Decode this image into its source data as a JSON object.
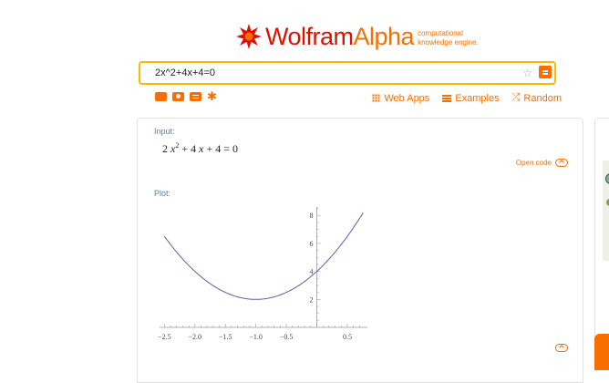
{
  "logo": {
    "brand_part1": "Wolfram",
    "brand_part2": "Alpha",
    "tagline_line1": "computational",
    "tagline_line2": "knowledge engine."
  },
  "search": {
    "value": "2x^2+4x+4=0"
  },
  "toolbar": {
    "icons": [
      "keyboard-icon",
      "camera-icon",
      "list-icon",
      "puzzle-icon"
    ],
    "links": {
      "web_apps": "Web Apps",
      "examples": "Examples",
      "random": "Random"
    }
  },
  "pods": {
    "input": {
      "title": "Input:",
      "open_code": "Open code"
    },
    "plot": {
      "title": "Plot:"
    }
  },
  "chart_data": {
    "type": "line",
    "function": "2x^2+4x+4",
    "x": [
      -2.5,
      -2.25,
      -2.0,
      -1.75,
      -1.5,
      -1.25,
      -1.0,
      -0.75,
      -0.5,
      -0.25,
      0.0,
      0.25,
      0.5,
      0.75
    ],
    "y": [
      6.5,
      5.125,
      4.0,
      3.125,
      2.5,
      2.125,
      2.0,
      2.125,
      2.5,
      3.125,
      4.0,
      5.125,
      6.5,
      8.125
    ],
    "xticks": [
      "-2.5",
      "-2.0",
      "-1.5",
      "-1.0",
      "-0.5",
      "0.5"
    ],
    "yticks": [
      "2",
      "4",
      "6",
      "8"
    ],
    "xlim": [
      -2.55,
      0.8
    ],
    "ylim": [
      0,
      8.6
    ],
    "grid": false,
    "color": "#5e5ea8"
  },
  "colors": {
    "accent": "#f96e00",
    "brand_red": "#dd1100",
    "search_border": "#ffb700",
    "pod_title": "#5f7f9f"
  }
}
